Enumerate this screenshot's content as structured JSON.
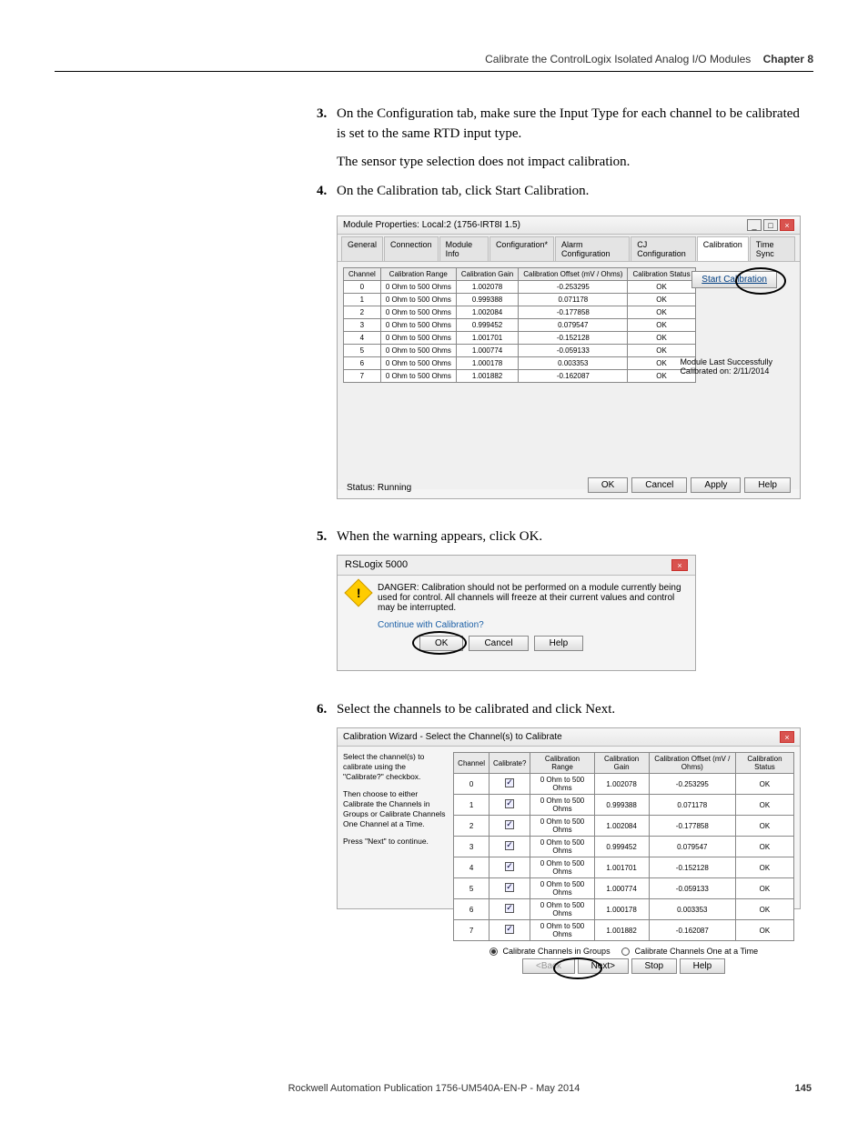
{
  "header": {
    "title": "Calibrate the ControlLogix Isolated Analog I/O Modules",
    "chapter": "Chapter 8"
  },
  "steps": {
    "s3_num": "3.",
    "s3": "On the Configuration tab, make sure the Input Type for each channel to be calibrated is set to the same RTD input type.",
    "s3_note": "The sensor type selection does not impact calibration.",
    "s4_num": "4.",
    "s4": "On the Calibration tab, click Start Calibration.",
    "s5_num": "5.",
    "s5": "When the warning appears, click OK.",
    "s6_num": "6.",
    "s6": "Select the channels to be calibrated and click Next."
  },
  "fig1": {
    "title": "Module Properties: Local:2 (1756-IRT8I 1.5)",
    "tabs": [
      "General",
      "Connection",
      "Module Info",
      "Configuration*",
      "Alarm Configuration",
      "CJ Configuration",
      "Calibration",
      "Time Sync"
    ],
    "active_tab": 6,
    "table_headers": [
      "Channel",
      "Calibration Range",
      "Calibration Gain",
      "Calibration Offset (mV / Ohms)",
      "Calibration Status"
    ],
    "rows": [
      [
        "0",
        "0 Ohm to 500 Ohms",
        "1.002078",
        "-0.253295",
        "OK"
      ],
      [
        "1",
        "0 Ohm to 500 Ohms",
        "0.999388",
        "0.071178",
        "OK"
      ],
      [
        "2",
        "0 Ohm to 500 Ohms",
        "1.002084",
        "-0.177858",
        "OK"
      ],
      [
        "3",
        "0 Ohm to 500 Ohms",
        "0.999452",
        "0.079547",
        "OK"
      ],
      [
        "4",
        "0 Ohm to 500 Ohms",
        "1.001701",
        "-0.152128",
        "OK"
      ],
      [
        "5",
        "0 Ohm to 500 Ohms",
        "1.000774",
        "-0.059133",
        "OK"
      ],
      [
        "6",
        "0 Ohm to 500 Ohms",
        "1.000178",
        "0.003353",
        "OK"
      ],
      [
        "7",
        "0 Ohm to 500 Ohms",
        "1.001882",
        "-0.162087",
        "OK"
      ]
    ],
    "start_button": "Start Calibration",
    "side_line1": "Module Last Successfully",
    "side_line2": "Calibrated on: 2/11/2014",
    "status": "Status: Running",
    "btns": [
      "OK",
      "Cancel",
      "Apply",
      "Help"
    ]
  },
  "fig2": {
    "title": "RSLogix 5000",
    "danger": "DANGER: Calibration should not be performed on a module currently being used for control. All channels will freeze at their current values and control may be interrupted.",
    "question": "Continue with Calibration?",
    "btns": [
      "OK",
      "Cancel",
      "Help"
    ]
  },
  "fig3": {
    "title": "Calibration Wizard - Select the Channel(s) to Calibrate",
    "instr1": "Select the channel(s) to calibrate using the \"Calibrate?\" checkbox.",
    "instr2": "Then choose to either Calibrate the Channels in Groups or Calibrate Channels One Channel at a Time.",
    "instr3": "Press \"Next\" to continue.",
    "table_headers": [
      "Channel",
      "Calibrate?",
      "Calibration Range",
      "Calibration Gain",
      "Calibration Offset (mV / Ohms)",
      "Calibration Status"
    ],
    "rows": [
      [
        "0",
        "0 Ohm to 500 Ohms",
        "1.002078",
        "-0.253295",
        "OK"
      ],
      [
        "1",
        "0 Ohm to 500 Ohms",
        "0.999388",
        "0.071178",
        "OK"
      ],
      [
        "2",
        "0 Ohm to 500 Ohms",
        "1.002084",
        "-0.177858",
        "OK"
      ],
      [
        "3",
        "0 Ohm to 500 Ohms",
        "0.999452",
        "0.079547",
        "OK"
      ],
      [
        "4",
        "0 Ohm to 500 Ohms",
        "1.001701",
        "-0.152128",
        "OK"
      ],
      [
        "5",
        "0 Ohm to 500 Ohms",
        "1.000774",
        "-0.059133",
        "OK"
      ],
      [
        "6",
        "0 Ohm to 500 Ohms",
        "1.000178",
        "0.003353",
        "OK"
      ],
      [
        "7",
        "0 Ohm to 500 Ohms",
        "1.001882",
        "-0.162087",
        "OK"
      ]
    ],
    "radio1": "Calibrate Channels in Groups",
    "radio2": "Calibrate Channels One at a Time",
    "btns": [
      "<Back",
      "Next>",
      "Stop",
      "Help"
    ]
  },
  "footer": {
    "pub": "Rockwell Automation Publication 1756-UM540A-EN-P - May 2014",
    "page": "145"
  }
}
